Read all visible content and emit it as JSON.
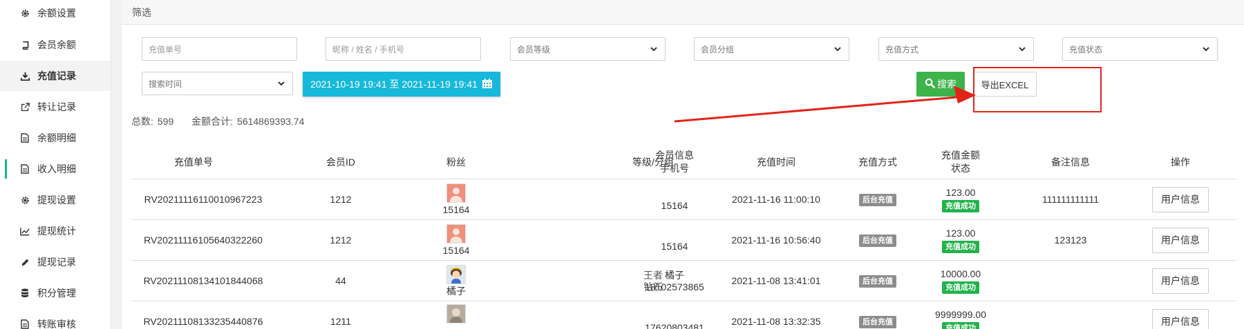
{
  "sidebar": {
    "items": [
      {
        "label": "余额设置",
        "icon": "gear-icon"
      },
      {
        "label": "会员余额",
        "icon": "book-icon"
      },
      {
        "label": "充值记录",
        "icon": "download-icon"
      },
      {
        "label": "转让记录",
        "icon": "external-link-icon"
      },
      {
        "label": "余额明细",
        "icon": "document-icon"
      },
      {
        "label": "收入明细",
        "icon": "document-icon"
      },
      {
        "label": "提现设置",
        "icon": "gear-icon"
      },
      {
        "label": "提现统计",
        "icon": "line-chart-icon"
      },
      {
        "label": "提现记录",
        "icon": "pencil-icon"
      },
      {
        "label": "积分管理",
        "icon": "database-icon"
      },
      {
        "label": "转账审核",
        "icon": "document-icon"
      }
    ]
  },
  "filter": {
    "title": "筛选",
    "order_no_placeholder": "充值单号",
    "member_placeholder": "昵称 / 姓名 / 手机号",
    "level_select": "会员等级",
    "group_select": "会员分组",
    "method_select": "充值方式",
    "status_select": "充值状态",
    "time_select": "搜索时间",
    "date_range": "2021-10-19 19:41 至 2021-11-19 19:41",
    "search_label": "搜索",
    "export_label": "导出EXCEL"
  },
  "summary": {
    "total_label": "总数:",
    "total_value": "599",
    "amount_label": "金额合计:",
    "amount_value": "5614869393.74"
  },
  "table": {
    "headers": {
      "order_no": "充值单号",
      "member_id": "会员ID",
      "fans": "粉丝",
      "member_info_1": "会员信息",
      "member_info_2": "手机号",
      "level_group": "等级/分组",
      "time": "充值时间",
      "method": "充值方式",
      "amount_1": "充值金额",
      "amount_2": "状态",
      "remark": "备注信息",
      "action": "操作"
    },
    "rows": [
      {
        "order_no": "RV20211116110010967223",
        "member_id": "1212",
        "fans": "15164",
        "info_name": "",
        "info_phone": "15164",
        "level": "",
        "group": "",
        "time": "2021-11-16 11:00:10",
        "method": "后台充值",
        "amount": "123.00",
        "status": "充值成功",
        "remark": "111111111111",
        "action": "用户信息"
      },
      {
        "order_no": "RV20211116105640322260",
        "member_id": "1212",
        "fans": "15164",
        "info_name": "",
        "info_phone": "15164",
        "level": "",
        "group": "",
        "time": "2021-11-16 10:56:40",
        "method": "后台充值",
        "amount": "123.00",
        "status": "充值成功",
        "remark": "123123",
        "action": "用户信息"
      },
      {
        "order_no": "RV20211108134101844068",
        "member_id": "44",
        "fans": "橘子",
        "info_name": "橘子",
        "info_phone": "18102573865",
        "level": "王者",
        "group": "钻石",
        "time": "2021-11-08 13:41:01",
        "method": "后台充值",
        "amount": "10000.00",
        "status": "充值成功",
        "remark": "",
        "action": "用户信息"
      },
      {
        "order_no": "RV20211108133235440876",
        "member_id": "1211",
        "fans": "",
        "info_name": "",
        "info_phone": "17620803481",
        "level": "",
        "group": "",
        "time": "2021-11-08 13:32:35",
        "method": "后台充值",
        "amount": "9999999.00",
        "status": "充值成功",
        "remark": "",
        "action": "用户信息"
      }
    ]
  },
  "colors": {
    "accent_cyan": "#17b8d9",
    "search_green": "#3db34a",
    "status_green": "#22b24c",
    "annotation_red": "#e2231a"
  }
}
